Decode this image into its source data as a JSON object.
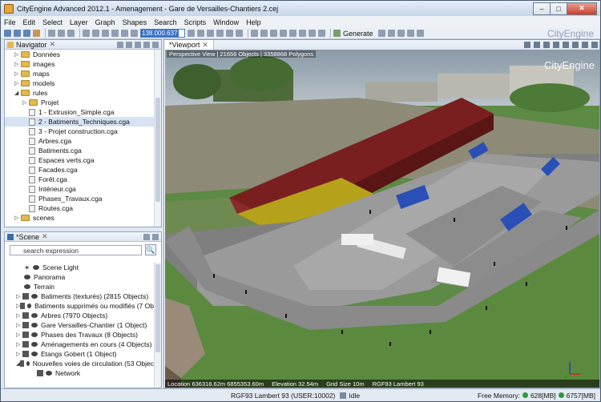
{
  "window": {
    "title": "CityEngine Advanced 2012.1 - Amenagement - Gare de Versailles-Chantiers 2.cej"
  },
  "menu": [
    "File",
    "Edit",
    "Select",
    "Layer",
    "Graph",
    "Shapes",
    "Search",
    "Scripts",
    "Window",
    "Help"
  ],
  "toolbar": {
    "zoom_value": "138.000.637",
    "generate_label": "Generate",
    "brand": "CityEngine"
  },
  "navigator": {
    "tab_label": "Navigator",
    "items": [
      {
        "label": "Données",
        "kind": "folder",
        "indent": 1
      },
      {
        "label": "images",
        "kind": "folder",
        "indent": 1
      },
      {
        "label": "maps",
        "kind": "folder",
        "indent": 1
      },
      {
        "label": "models",
        "kind": "folder",
        "indent": 1
      },
      {
        "label": "rules",
        "kind": "folder",
        "indent": 1,
        "open": true
      },
      {
        "label": "Projet",
        "kind": "folder",
        "indent": 2
      },
      {
        "label": "1 - Extrusion_Simple.cga",
        "kind": "file",
        "indent": 2
      },
      {
        "label": "2 - Batiments_Techniques.cga",
        "kind": "file",
        "indent": 2,
        "selected": true
      },
      {
        "label": "3 - Projet construction.cga",
        "kind": "file",
        "indent": 2
      },
      {
        "label": "Arbres.cga",
        "kind": "file",
        "indent": 2
      },
      {
        "label": "Batiments.cga",
        "kind": "file",
        "indent": 2
      },
      {
        "label": "Espaces verts.cga",
        "kind": "file",
        "indent": 2
      },
      {
        "label": "Facades.cga",
        "kind": "file",
        "indent": 2
      },
      {
        "label": "Forêt.cga",
        "kind": "file",
        "indent": 2
      },
      {
        "label": "Intérieur.cga",
        "kind": "file",
        "indent": 2
      },
      {
        "label": "Phases_Travaux.cga",
        "kind": "file",
        "indent": 2
      },
      {
        "label": "Routes.cga",
        "kind": "file",
        "indent": 2
      },
      {
        "label": "scenes",
        "kind": "folder",
        "indent": 1
      }
    ]
  },
  "scene_panel": {
    "tab_label": "*Scene",
    "search_placeholder": "search expression",
    "items": [
      {
        "label": "Scene Light",
        "icon": "sun"
      },
      {
        "label": "Panorama",
        "icon": "eye"
      },
      {
        "label": "Terrain",
        "icon": "eye"
      },
      {
        "label": "Batiments (texturés) (2815 Objects)",
        "icon": "obj"
      },
      {
        "label": "Batiments supprimés ou modifiés (7 Ob",
        "icon": "obj"
      },
      {
        "label": "Arbres (7970 Objects)",
        "icon": "obj"
      },
      {
        "label": "Gare Versailles-Chantier (1 Object)",
        "icon": "obj"
      },
      {
        "label": "Phases des Travaux (8 Objects)",
        "icon": "obj"
      },
      {
        "label": "Aménagements en cours (4 Objects)",
        "icon": "obj"
      },
      {
        "label": "Etangs Gobert (1 Object)",
        "icon": "obj"
      },
      {
        "label": "Nouvelles voies de circulation (53 Objec",
        "icon": "obj"
      },
      {
        "label": "Network",
        "icon": "obj"
      }
    ]
  },
  "viewport": {
    "tab_label": "*Viewport",
    "hud_top": "Perspective View  |  21656 Objects  |  3358868 Polygons",
    "hud_location": "Location 636318.62m 6855353.60m",
    "hud_elevation": "Elevation 32.54m",
    "hud_grid": "Grid Size 10m",
    "hud_crs": "RGF93 Lambert 93",
    "brand_overlay": "CityEngine"
  },
  "status": {
    "crs": "RGF93 Lambert 93 (USER:10002)",
    "state": "Idle",
    "free_memory_label": "Free Memory:",
    "mem1": "628[MB]",
    "mem2": "6757[MB]"
  }
}
